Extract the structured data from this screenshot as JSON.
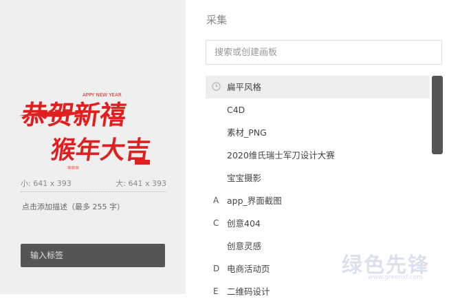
{
  "left_panel": {
    "preview_text": {
      "line1": "恭贺新禧",
      "line2": "猴年大吉",
      "english": "APPY NEW YEAR",
      "seal": "■■■"
    },
    "small_size": "小: 641 x 393",
    "large_size": "大: 641 x 393",
    "description_prompt": "点击添加描述（最多 255 字）",
    "tag_input_placeholder": "输入标签"
  },
  "right_panel": {
    "title": "采集",
    "search_placeholder": "搜索或创建画板",
    "boards": [
      {
        "letter": "",
        "label": "扁平风格",
        "recent": true
      },
      {
        "letter": "",
        "label": "C4D"
      },
      {
        "letter": "",
        "label": "素材_PNG"
      },
      {
        "letter": "",
        "label": "2020维氏瑞士军刀设计大赛"
      },
      {
        "letter": "",
        "label": "宝宝摄影"
      },
      {
        "letter": "A",
        "label": "app_界面截图"
      },
      {
        "letter": "C",
        "label": "创意404"
      },
      {
        "letter": "",
        "label": "创意灵感"
      },
      {
        "letter": "D",
        "label": "电商活动页"
      },
      {
        "letter": "E",
        "label": "二维码设计"
      }
    ]
  },
  "watermark": {
    "text": "绿色先锋",
    "url": "www.greenxf.com"
  },
  "colors": {
    "left_bg": "#efefef",
    "tag_input_bg": "#555555",
    "highlight_row": "#eeeeee",
    "scrollbar": "#555555",
    "calligraphy_red": "#e02020"
  }
}
